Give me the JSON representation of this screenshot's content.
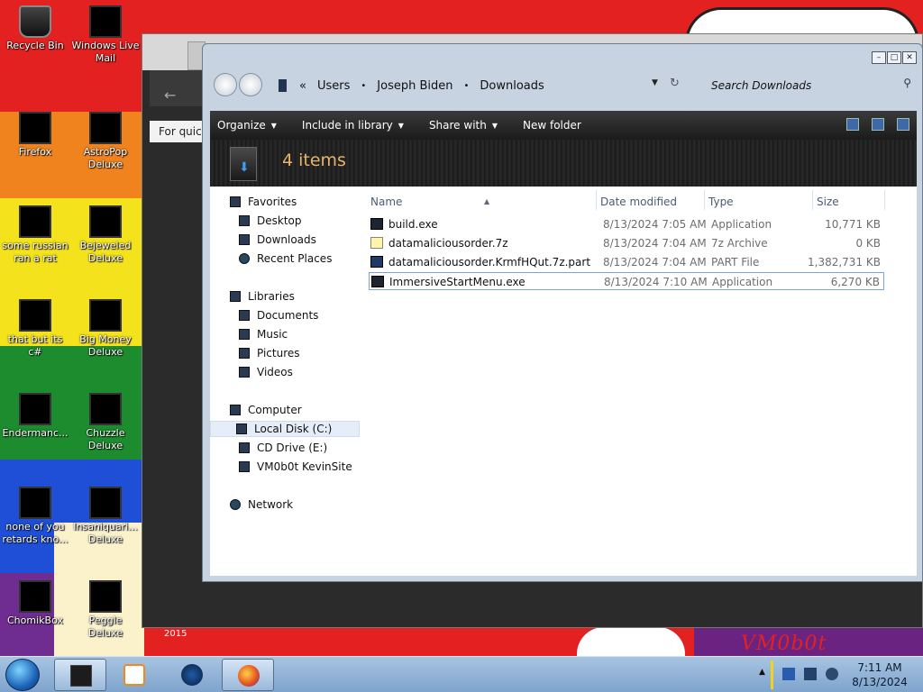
{
  "desktop": {
    "icons": [
      {
        "label": "Recycle Bin",
        "icon": "recycle-bin-icon"
      },
      {
        "label": "Windows Live Mail",
        "icon": "mail-icon"
      },
      {
        "label": "Firefox",
        "icon": "firefox-icon"
      },
      {
        "label": "AstroPop Deluxe",
        "icon": "game-icon"
      },
      {
        "label": "some russian ran a rat",
        "icon": "app-icon"
      },
      {
        "label": "Bejeweled Deluxe",
        "icon": "game-icon"
      },
      {
        "label": "that but its c#",
        "icon": "app-icon"
      },
      {
        "label": "Big Money Deluxe",
        "icon": "game-icon"
      },
      {
        "label": "Endermanc...",
        "icon": "app-icon"
      },
      {
        "label": "Chuzzle Deluxe",
        "icon": "game-icon"
      },
      {
        "label": "none of you retards kno...",
        "icon": "app-icon"
      },
      {
        "label": "Insaniquari... Deluxe",
        "icon": "game-icon"
      },
      {
        "label": "ChomikBox",
        "icon": "app-icon"
      },
      {
        "label": "Peggle Deluxe",
        "icon": "game-icon"
      }
    ],
    "watermark_brand": "VM0b0t",
    "year_label": "2015"
  },
  "browser": {
    "quick_text": "For quick"
  },
  "explorer": {
    "address": {
      "root_chevron": "«",
      "crumbs": [
        "Users",
        "Joseph Biden",
        "Downloads"
      ],
      "separator": "•"
    },
    "search_placeholder": "Search Downloads",
    "toolbar": {
      "organize": "Organize",
      "include_in_library": "Include in library",
      "share_with": "Share with",
      "new_folder": "New folder"
    },
    "item_count": "4 items",
    "nav": {
      "favorites": "Favorites",
      "desktop": "Desktop",
      "downloads": "Downloads",
      "recent_places": "Recent Places",
      "libraries": "Libraries",
      "documents": "Documents",
      "music": "Music",
      "pictures": "Pictures",
      "videos": "Videos",
      "computer": "Computer",
      "local_disk": "Local Disk (C:)",
      "cd_drive": "CD Drive (E:)",
      "network_share": "VM0b0t KevinSite",
      "network": "Network"
    },
    "columns": {
      "name": "Name",
      "date_modified": "Date modified",
      "type": "Type",
      "size": "Size"
    },
    "files": [
      {
        "name": "build.exe",
        "date": "8/13/2024 7:05 AM",
        "type": "Application",
        "size": "10,771 KB"
      },
      {
        "name": "datamaliciousorder.7z",
        "date": "8/13/2024 7:04 AM",
        "type": "7z Archive",
        "size": "0 KB"
      },
      {
        "name": "datamaliciousorder.KrmfHQut.7z.part",
        "date": "8/13/2024 7:04 AM",
        "type": "PART File",
        "size": "1,382,731 KB"
      },
      {
        "name": "ImmersiveStartMenu.exe",
        "date": "8/13/2024 7:10 AM",
        "type": "Application",
        "size": "6,270 KB"
      }
    ]
  },
  "taskbar": {
    "time": "7:11 AM",
    "date": "8/13/2024"
  }
}
